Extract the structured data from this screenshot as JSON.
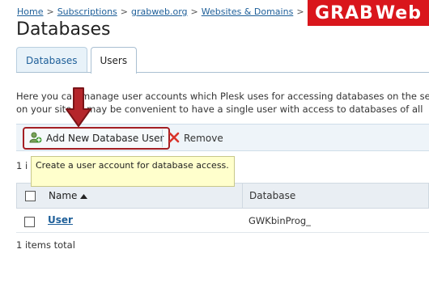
{
  "breadcrumb": {
    "items": [
      "Home",
      "Subscriptions",
      "grabweb.org",
      "Websites & Domains"
    ],
    "separator": ">"
  },
  "logo": {
    "part1": "GRAB",
    "part2": "Web"
  },
  "page_title": "Databases",
  "tabs": [
    {
      "label": "Databases",
      "active": false
    },
    {
      "label": "Users",
      "active": true
    }
  ],
  "description": {
    "line1": "Here you can manage user accounts which Plesk uses for accessing databases on the se",
    "line2": "on your site. It may be convenient to have a single user with access to databases of all"
  },
  "toolbar": {
    "add_label": "Add New Database User",
    "remove_label": "Remove"
  },
  "tooltip": {
    "text": "Create a user account for database access."
  },
  "count_top": "1 i",
  "table": {
    "columns": {
      "name": "Name",
      "database": "Database"
    },
    "rows": [
      {
        "name": "User",
        "database": "GWKbinProg_"
      }
    ]
  },
  "count_bottom": "1 items total",
  "colors": {
    "accent": "#1e5f99",
    "highlight": "#a41f24",
    "logo_bg": "#d9161c"
  }
}
